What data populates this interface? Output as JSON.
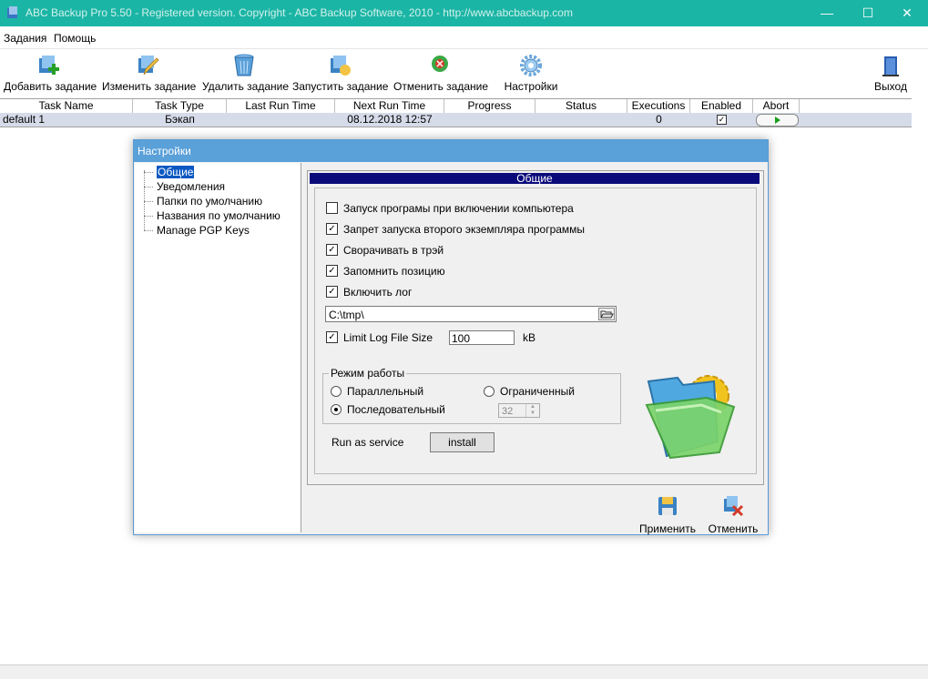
{
  "window": {
    "title": "ABC Backup Pro 5.50 - Registered version. Copyright - ABC Backup Software, 2010 - http://www.abcbackup.com",
    "minimize": "—",
    "maximize": "☐",
    "close": "✕"
  },
  "menu": {
    "items": [
      "Задания",
      "Помощь"
    ]
  },
  "toolbar": {
    "add": "Добавить задание",
    "edit": "Изменить задание",
    "delete": "Удалить задание",
    "run": "Запустить задание",
    "cancel": "Отменить задание",
    "settings": "Настройки",
    "exit": "Выход"
  },
  "grid": {
    "columns": [
      "Task Name",
      "Task Type",
      "Last Run Time",
      "Next Run Time",
      "Progress",
      "Status",
      "Executions",
      "Enabled",
      "Abort"
    ],
    "rows": [
      {
        "task_name": "default 1",
        "task_type": "Бэкап",
        "last_run": "",
        "next_run": "08.12.2018 12:57",
        "progress": "",
        "status": "",
        "executions": "0",
        "enabled": "✓"
      }
    ]
  },
  "dialog": {
    "title": "Настройки",
    "tree": [
      "Общие",
      "Уведомления",
      "Папки по умолчанию",
      "Названия по умолчанию",
      "Manage PGP Keys"
    ],
    "panel_header": "Общие",
    "options": [
      {
        "label": "Запуск програмы при включении компьютера",
        "checked": ""
      },
      {
        "label": "Запрет запуска второго экземпляра программы",
        "checked": "✓"
      },
      {
        "label": "Сворачивать в трэй",
        "checked": "✓"
      },
      {
        "label": "Запомнить позицию",
        "checked": "✓"
      },
      {
        "label": "Включить лог",
        "checked": "✓"
      }
    ],
    "log_path": "C:\\tmp\\",
    "limit_log": {
      "label": "Limit Log File Size",
      "checked": "✓",
      "value": "100",
      "unit": "kB"
    },
    "mode": {
      "title": "Режим работы",
      "parallel": "Параллельный",
      "limited": "Ограниченный",
      "sequential": "Последовательный",
      "limit_value": "32"
    },
    "service": {
      "label": "Run as service",
      "button": "install"
    },
    "apply": "Применить",
    "cancel": "Отменить"
  }
}
